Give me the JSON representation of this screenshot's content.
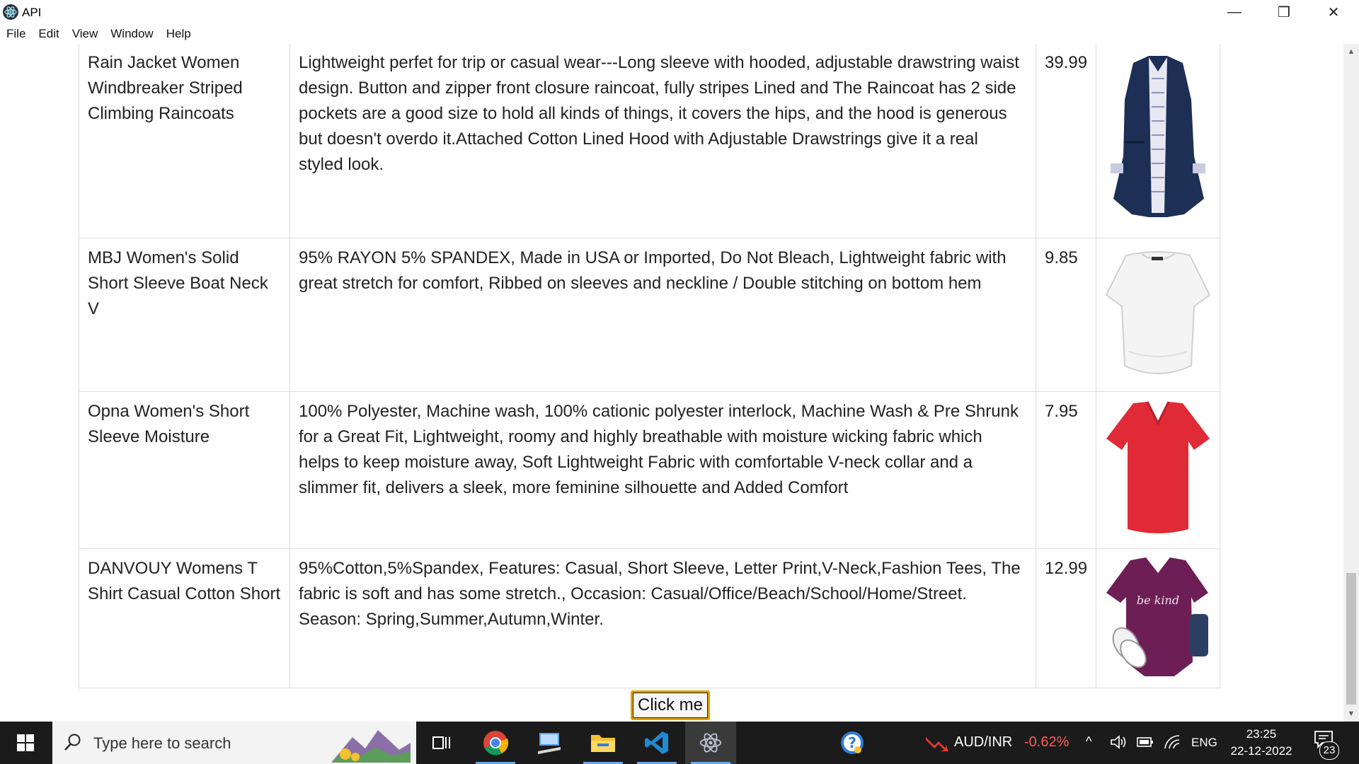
{
  "window": {
    "title": "API",
    "minimize_glyph": "—",
    "maximize_glyph": "❐",
    "close_glyph": "✕"
  },
  "menu": [
    "File",
    "Edit",
    "View",
    "Window",
    "Help"
  ],
  "products": [
    {
      "name": "Rain Jacket Women Windbreaker Striped Climbing Raincoats",
      "description": "Lightweight perfet for trip or casual wear---Long sleeve with hooded, adjustable drawstring waist design. Button and zipper front closure raincoat, fully stripes Lined and The Raincoat has 2 side pockets are a good size to hold all kinds of things, it covers the hips, and the hood is generous but doesn't overdo it.Attached Cotton Lined Hood with Adjustable Drawstrings give it a real styled look.",
      "price": "39.99",
      "image_icon": "navy-raincoat-image"
    },
    {
      "name": "MBJ Women's Solid Short Sleeve Boat Neck V",
      "description": "95% RAYON 5% SPANDEX, Made in USA or Imported, Do Not Bleach, Lightweight fabric with great stretch for comfort, Ribbed on sleeves and neckline / Double stitching on bottom hem",
      "price": "9.85",
      "image_icon": "white-tshirt-image"
    },
    {
      "name": "Opna Women's Short Sleeve Moisture",
      "description": "100% Polyester, Machine wash, 100% cationic polyester interlock, Machine Wash & Pre Shrunk for a Great Fit, Lightweight, roomy and highly breathable with moisture wicking fabric which helps to keep moisture away, Soft Lightweight Fabric with comfortable V-neck collar and a slimmer fit, delivers a sleek, more feminine silhouette and Added Comfort",
      "price": "7.95",
      "image_icon": "red-tshirt-image"
    },
    {
      "name": "DANVOUY Womens T Shirt Casual Cotton Short",
      "description": "95%Cotton,5%Spandex, Features: Casual, Short Sleeve, Letter Print,V-Neck,Fashion Tees, The fabric is soft and has some stretch., Occasion: Casual/Office/Beach/School/Home/Street. Season: Spring,Summer,Autumn,Winter.",
      "price": "12.99",
      "image_icon": "purple-tshirt-image",
      "image_text": "be kind"
    }
  ],
  "button": {
    "label": "Click me"
  },
  "taskbar": {
    "search_placeholder": "Type here to search",
    "stock_label": "AUD/INR",
    "stock_change": "-0.62%",
    "language": "ENG",
    "time": "23:25",
    "date": "22-12-2022",
    "notification_count": "23"
  },
  "colors": {
    "accent_button_border": "#e0a100",
    "taskbar_bg": "#1b1b1b",
    "stock_negative": "#ff5b5b",
    "raincoat": "#1d2f55",
    "red_shirt": "#e02a36",
    "purple_shirt": "#6d1f55"
  }
}
